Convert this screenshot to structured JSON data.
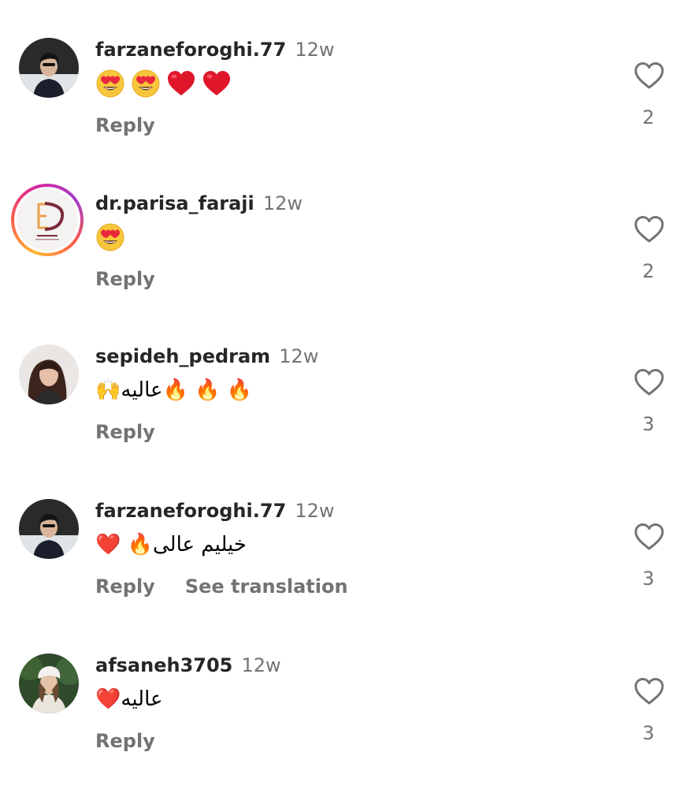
{
  "comments": [
    {
      "username": "farzaneforoghi.77",
      "time": "12w",
      "text": "",
      "emojis": [
        "heart-eyes",
        "heart-eyes",
        "red-heart",
        "red-heart"
      ],
      "reply_label": "Reply",
      "likes": "2"
    },
    {
      "username": "dr.parisa_faraji",
      "time": "12w",
      "text": "",
      "emojis": [
        "heart-eyes"
      ],
      "reply_label": "Reply",
      "likes": "2"
    },
    {
      "username": "sepideh_pedram",
      "time": "12w",
      "text": "🔥 🔥 🔥عالیه🙌",
      "reply_label": "Reply",
      "likes": "3"
    },
    {
      "username": "farzaneforoghi.77",
      "time": "12w",
      "text": "خیلیم عالی🔥 ❤️",
      "reply_label": "Reply",
      "translate_label": "See translation",
      "likes": "3"
    },
    {
      "username": "afsaneh3705",
      "time": "12w",
      "text": "عالیه❤️",
      "reply_label": "Reply",
      "likes": "3"
    }
  ],
  "colors": {
    "username": "#262626",
    "secondary_text": "#737373",
    "avatar_ring": [
      "#fdb733",
      "#fd5949",
      "#d6249f",
      "#a03cc9"
    ]
  }
}
